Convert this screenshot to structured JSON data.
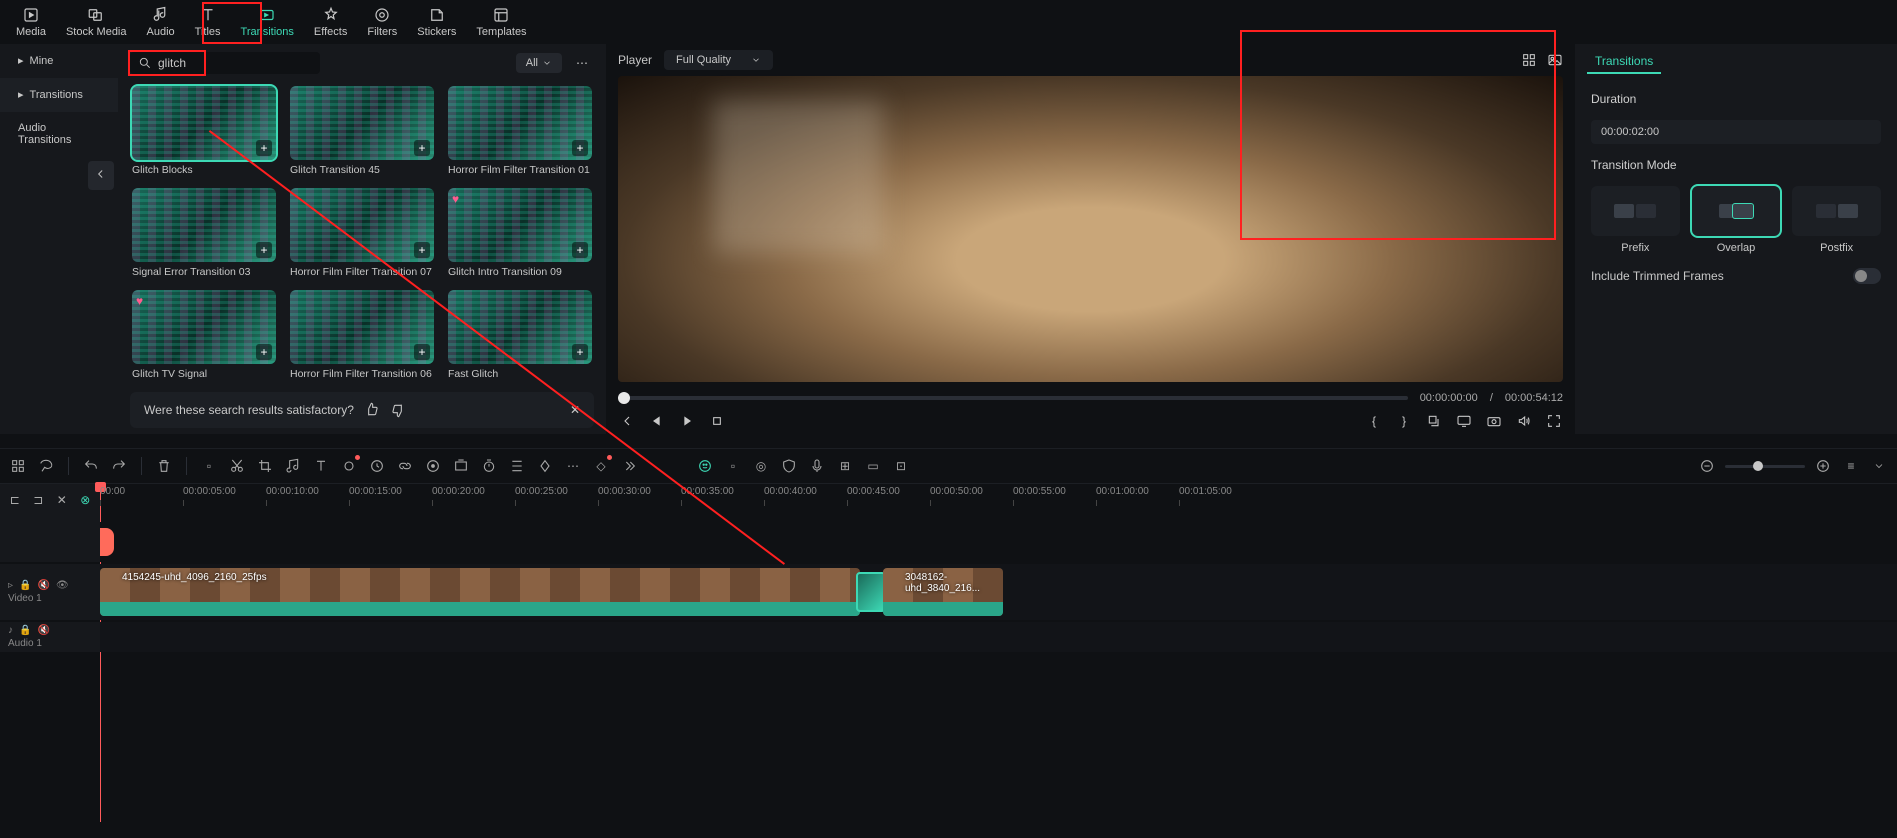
{
  "top_tabs": {
    "media": "Media",
    "stock": "Stock Media",
    "audio": "Audio",
    "titles": "Titles",
    "transitions": "Transitions",
    "effects": "Effects",
    "filters": "Filters",
    "stickers": "Stickers",
    "templates": "Templates"
  },
  "sidebar": {
    "mine": "Mine",
    "transitions": "Transitions",
    "audio_transitions": "Audio Transitions"
  },
  "search": {
    "value": "glitch"
  },
  "filter_chip": "All",
  "thumbs": [
    {
      "label": "Glitch Blocks",
      "selected": true,
      "heart": false
    },
    {
      "label": "Glitch Transition 45",
      "selected": false,
      "heart": false
    },
    {
      "label": "Horror Film Filter Transition 01",
      "selected": false,
      "heart": false
    },
    {
      "label": "Signal Error Transition 03",
      "selected": false,
      "heart": false
    },
    {
      "label": "Horror Film Filter Transition 07",
      "selected": false,
      "heart": false
    },
    {
      "label": "Glitch Intro Transition 09",
      "selected": false,
      "heart": true
    },
    {
      "label": "Glitch TV Signal",
      "selected": false,
      "heart": true
    },
    {
      "label": "Horror Film Filter Transition 06",
      "selected": false,
      "heart": false
    },
    {
      "label": "Fast Glitch",
      "selected": false,
      "heart": false
    }
  ],
  "feedback": {
    "text": "Were these search results satisfactory?"
  },
  "player": {
    "label": "Player",
    "quality": "Full Quality",
    "current": "00:00:00:00",
    "sep": "/",
    "total": "00:00:54:12"
  },
  "props": {
    "tab": "Transitions",
    "duration_label": "Duration",
    "duration_value": "00:00:02:00",
    "mode_label": "Transition Mode",
    "modes": {
      "prefix": "Prefix",
      "overlap": "Overlap",
      "postfix": "Postfix"
    },
    "trimmed_label": "Include Trimmed Frames"
  },
  "ruler": [
    "00:00",
    "00:00:05:00",
    "00:00:10:00",
    "00:00:15:00",
    "00:00:20:00",
    "00:00:25:00",
    "00:00:30:00",
    "00:00:35:00",
    "00:00:40:00",
    "00:00:45:00",
    "00:00:50:00",
    "00:00:55:00",
    "00:01:00:00",
    "00:01:05:00"
  ],
  "tracks": {
    "video1_name": "Video 1",
    "audio1_name": "Audio 1",
    "clip1": "4154245-uhd_4096_2160_25fps",
    "clip2": "3048162-uhd_3840_216..."
  }
}
